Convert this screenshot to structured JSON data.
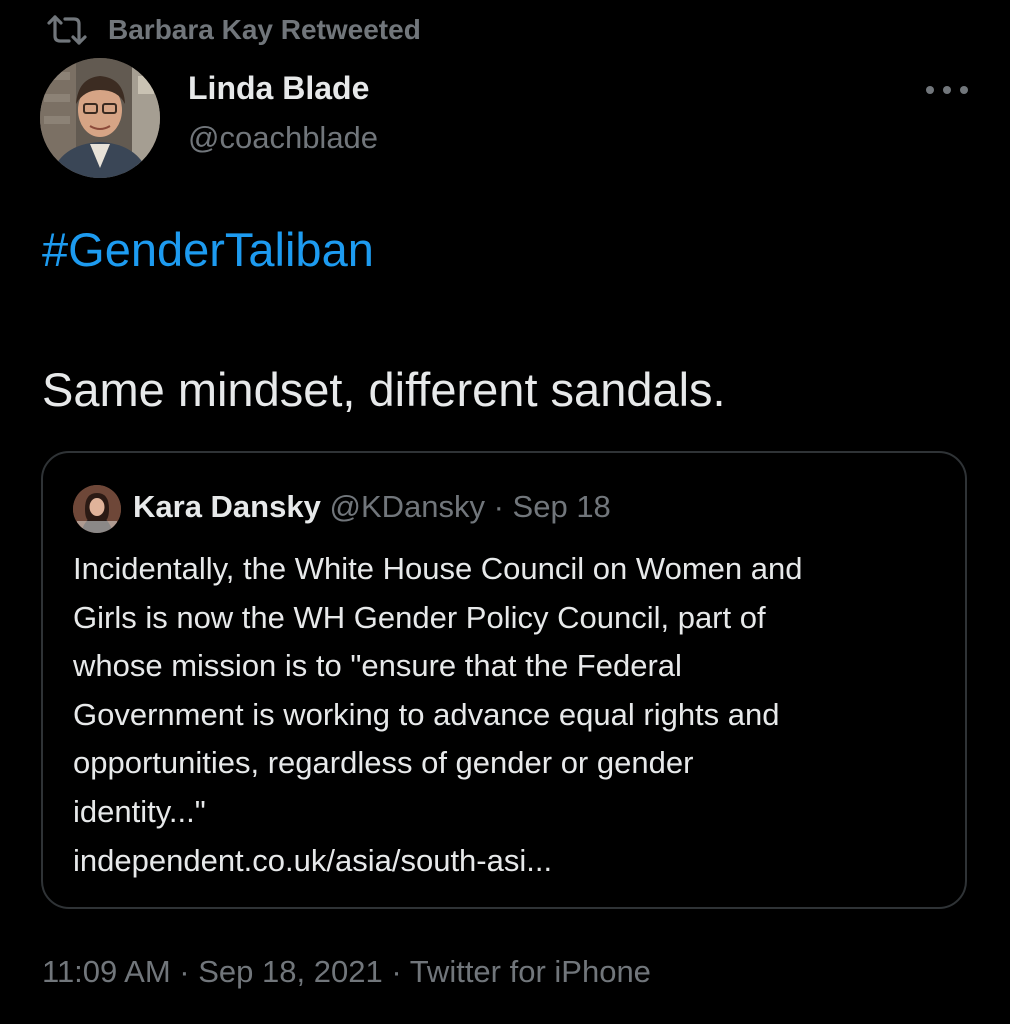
{
  "retweet": {
    "icon": "retweet-icon",
    "text": "Barbara Kay Retweeted"
  },
  "author": {
    "name": "Linda Blade",
    "handle": "@coachblade",
    "avatar": "avatar-photo"
  },
  "menu": {
    "icon": "more-dots-icon"
  },
  "tweet": {
    "hashtag": "#GenderTaliban",
    "text": "Same mindset, different sandals."
  },
  "quoted_tweet": {
    "name": "Kara Dansky",
    "handle": "@KDansky",
    "separator": " · ",
    "date": "Sep 18",
    "lines": [
      "Incidentally, the White House Council on Women and",
      "Girls is now the WH Gender Policy Council, part of",
      "whose mission is to \"ensure that the Federal",
      "Government is working to advance equal rights and",
      "opportunities, regardless of gender or gender",
      "identity...\"",
      "independent.co.uk/asia/south-asi..."
    ]
  },
  "footer": {
    "time": "11:09 AM",
    "separator": " · ",
    "date": "Sep 18, 2021",
    "source": "Twitter for iPhone"
  },
  "colors": {
    "background": "#000000",
    "primary_text": "#e7e9ea",
    "secondary_text": "#71767b",
    "link": "#1d9bf0",
    "border": "#2f3336"
  }
}
